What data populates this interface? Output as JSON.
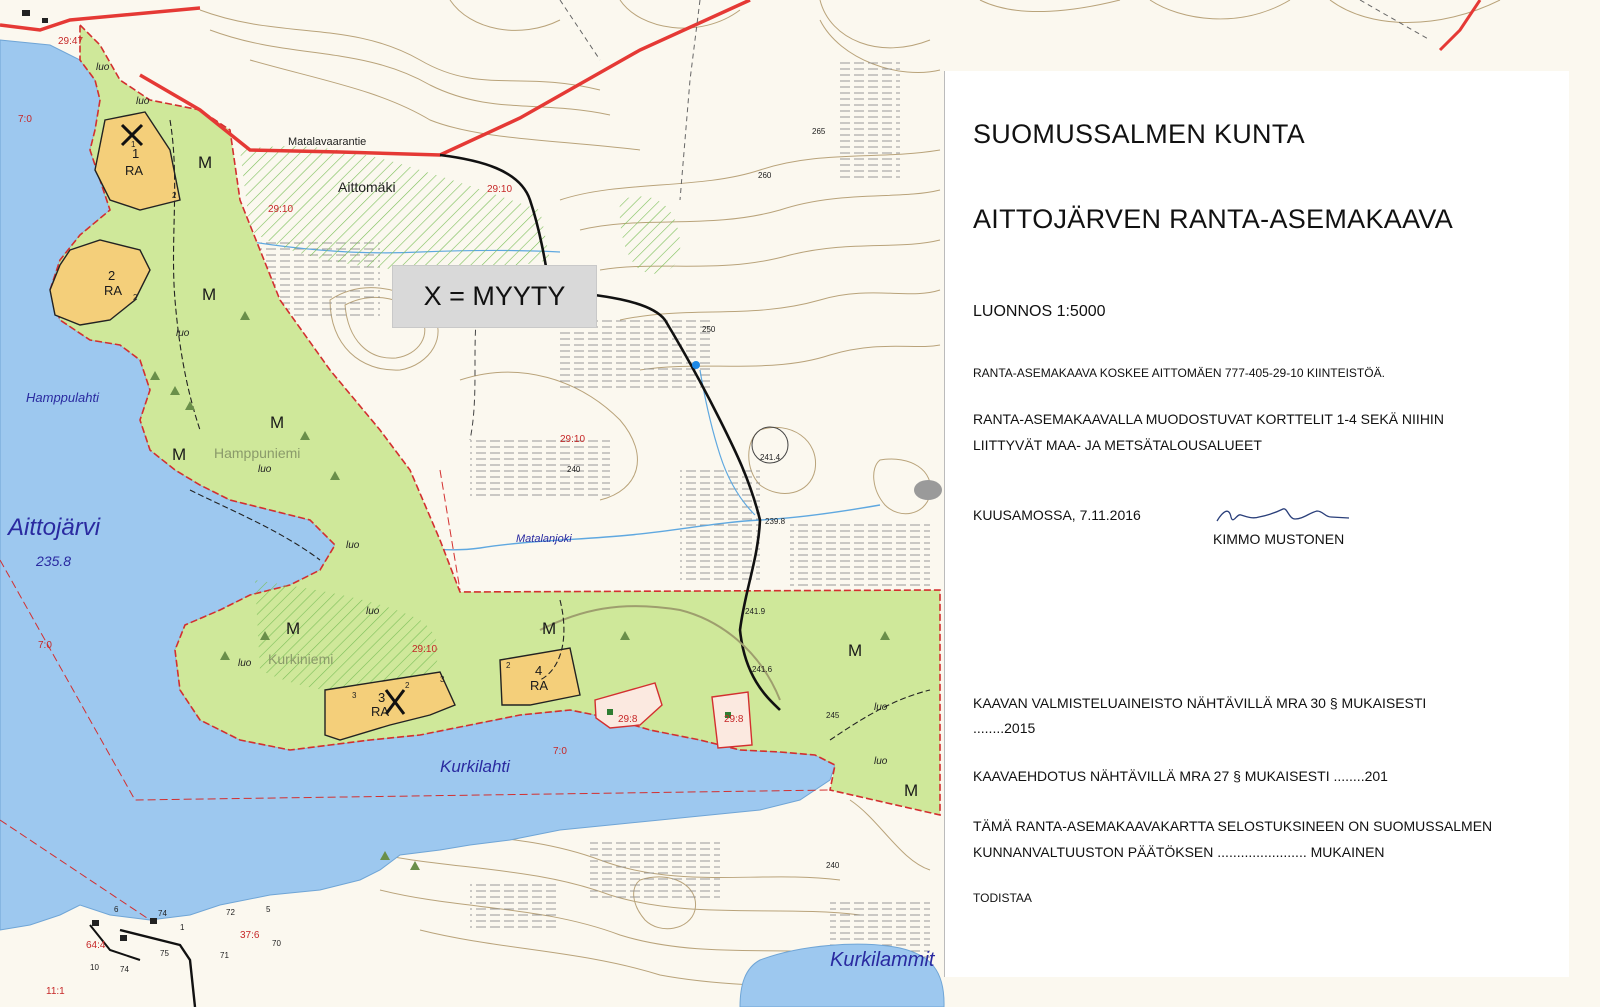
{
  "title_block": {
    "municipality": "SUOMUSSALMEN KUNTA",
    "plan_name": "AITTOJÄRVEN RANTA-ASEMAKAAVA",
    "draft_scale": "LUONNOS 1:5000",
    "property_note": "RANTA-ASEMAKAAVA KOSKEE AITTOMÄEN 777-405-29-10 KIINTEISTÖÄ.",
    "blocks_note_line1": "RANTA-ASEMAKAAVALLA MUODOSTUVAT KORTTELIT 1-4 SEKÄ NIIHIN",
    "blocks_note_line2": "LIITTYVÄT MAA- JA METSÄTALOUSALUEET",
    "place_date": "KUUSAMOSSA, 7.11.2016",
    "signer": "KIMMO MUSTONEN",
    "prep_material_line1": "KAAVAN VALMISTELUAINEISTO NÄHTÄVILLÄ MRA 30 § MUKAISESTI",
    "prep_material_line2": "........2015",
    "proposal_line": "KAAVAEHDOTUS NÄHTÄVILLÄ MRA 27 § MUKAISESTI ........201",
    "approval_line1": "TÄMÄ RANTA-ASEMAKAAVAKARTTA SELOSTUKSINEEN ON SUOMUSSALMEN",
    "approval_line2": "KUNNANVALTUUSTON PÄÄTÖKSEN       ....................... MUKAINEN",
    "certify": "TODISTAA"
  },
  "legend_note": "X = MYYTY",
  "map": {
    "place_names": {
      "lake": "Aittojärvi",
      "lake_level": "235.8",
      "bay_west": "Hamppulahti",
      "bay_south": "Kurkilahti",
      "cape_hamppuniemi": "Hamppuniemi",
      "cape_kurkiniemi": "Kurkiniemi",
      "hill": "Aittomäki",
      "road": "Matalavaarantie",
      "stream": "Matalanjoki",
      "ponds": "Kurkilammit"
    },
    "zone_labels": {
      "forest": "M",
      "holiday_housing": "RA",
      "nature_value": "luo",
      "sold_marker": "X"
    },
    "plot_numbers": [
      "1",
      "2",
      "3",
      "4"
    ],
    "plot_edge_numbers": [
      "1",
      "2",
      "2",
      "3",
      "2",
      "3",
      "2"
    ],
    "property_ids": [
      "29:10",
      "29:10",
      "29:10",
      "29:10",
      "29:47",
      "29:8",
      "29:8",
      "7:0",
      "7:0",
      "7:0",
      "11:1",
      "64:4",
      "37:6"
    ],
    "elevations": [
      "239.8",
      "241.9",
      "241.6",
      "241.4",
      "265",
      "260",
      "250",
      "240",
      "245",
      "240"
    ],
    "parcel_point_numbers": [
      "6",
      "74",
      "72",
      "5",
      "70",
      "71",
      "75",
      "10",
      "74",
      "1"
    ],
    "colors": {
      "water": "#9dc8ef",
      "forest_zone": "#cfe89a",
      "ra_zone": "#f4cf7a",
      "plan_border": "#d32f2f",
      "contour": "#b7a27a",
      "road": "#e53935"
    }
  }
}
